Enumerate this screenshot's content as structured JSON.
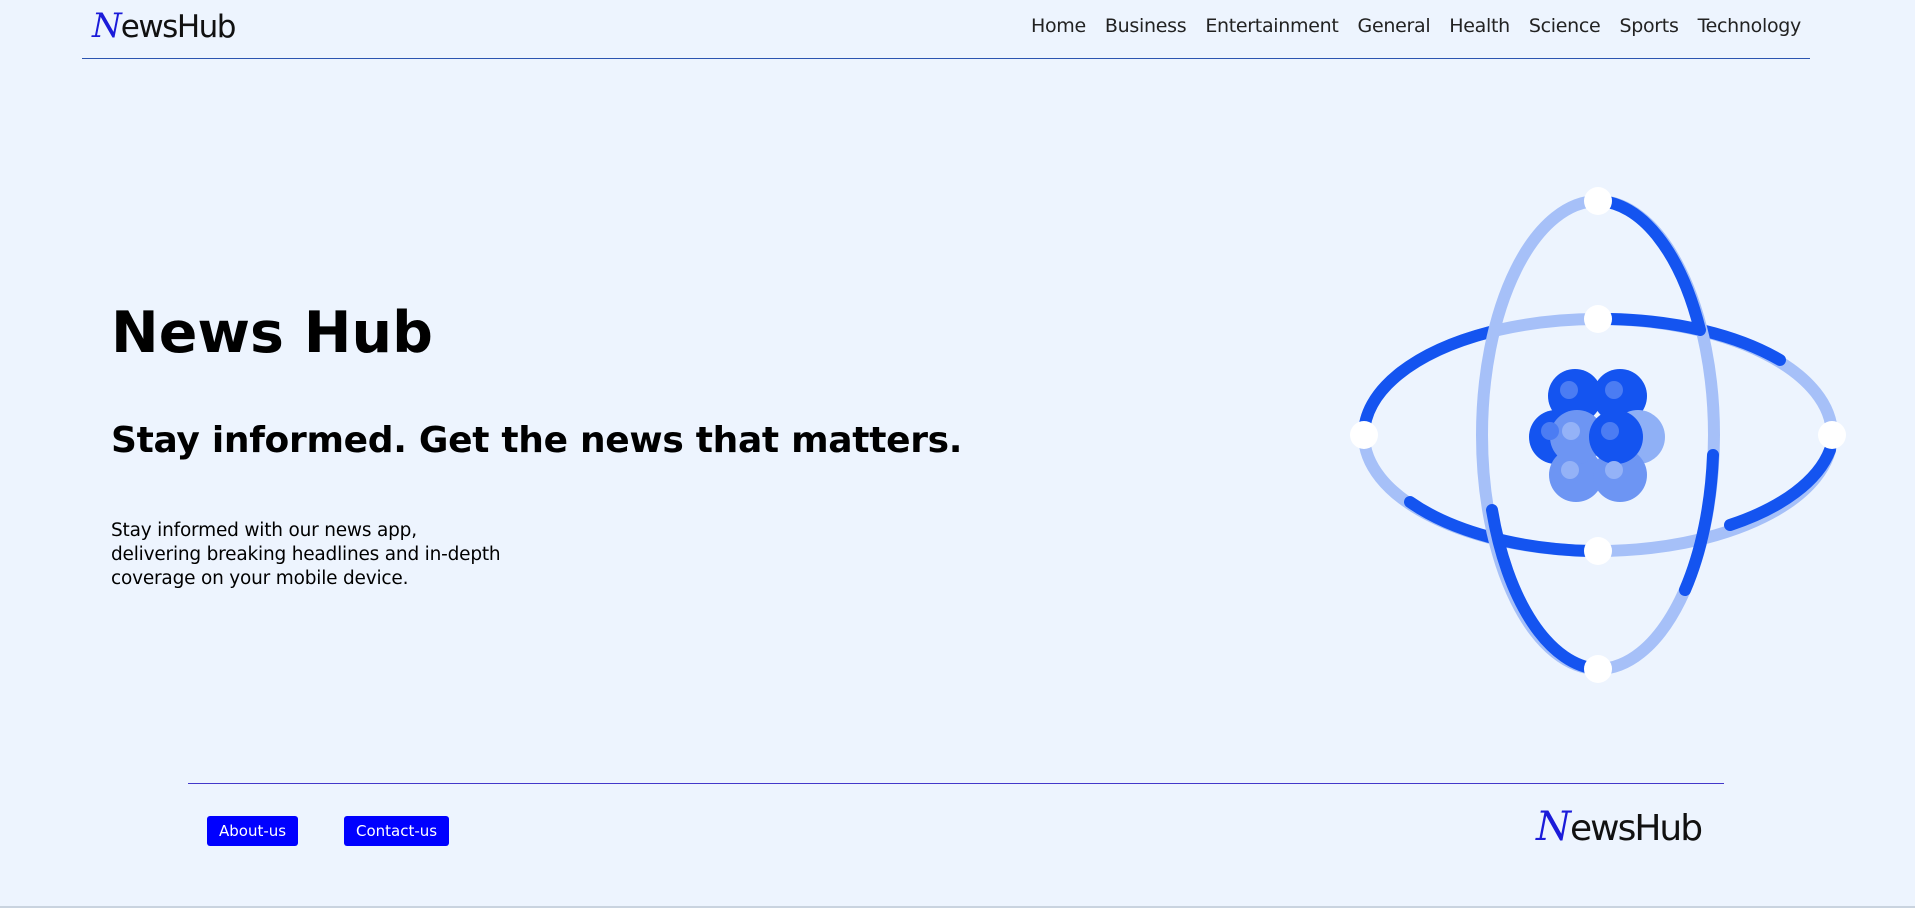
{
  "header": {
    "logo_initial": "N",
    "logo_rest": "ewsHub",
    "nav": [
      "Home",
      "Business",
      "Entertainment",
      "General",
      "Health",
      "Science",
      "Sports",
      "Technology"
    ]
  },
  "hero": {
    "title": "News Hub",
    "subtitle": "Stay informed. Get the news that matters.",
    "description_lines": [
      "Stay informed with our news app,",
      "delivering breaking headlines and in-depth",
      "coverage on your mobile device."
    ],
    "illustration_icon": "atom-icon"
  },
  "footer": {
    "about_label": "About-us",
    "contact_label": "Contact-us",
    "logo_initial": "N",
    "logo_rest": "ewsHub"
  },
  "colors": {
    "background": "#edf4fe",
    "accent": "#0000ff",
    "atom_dark": "#1454f0",
    "atom_light": "#a6c0f8"
  }
}
